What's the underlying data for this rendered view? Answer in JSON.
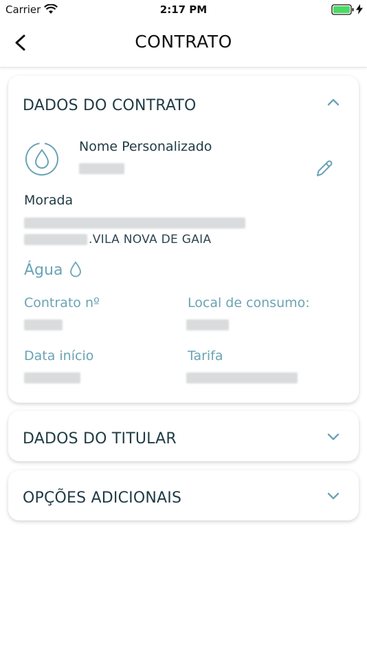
{
  "status_bar": {
    "carrier": "Carrier",
    "time": "2:17 PM",
    "battery_color": "#4cd964"
  },
  "nav": {
    "title": "CONTRATO"
  },
  "contract_section": {
    "title": "DADOS DO CONTRATO",
    "expanded": true,
    "custom_name_label": "Nome Personalizado",
    "address_label": "Morada",
    "address_city": ".VILA NOVA DE GAIA",
    "service_label": "Água",
    "contract_number_label": "Contrato nº",
    "consumption_place_label": "Local de consumo:",
    "start_date_label": "Data início",
    "tariff_label": "Tarifa"
  },
  "holder_section": {
    "title": "DADOS DO TITULAR",
    "expanded": false
  },
  "options_section": {
    "title": "OPÇÕES ADICIONAIS",
    "expanded": false
  },
  "colors": {
    "accent": "#6aa3b5",
    "heading": "#1f3a44"
  }
}
